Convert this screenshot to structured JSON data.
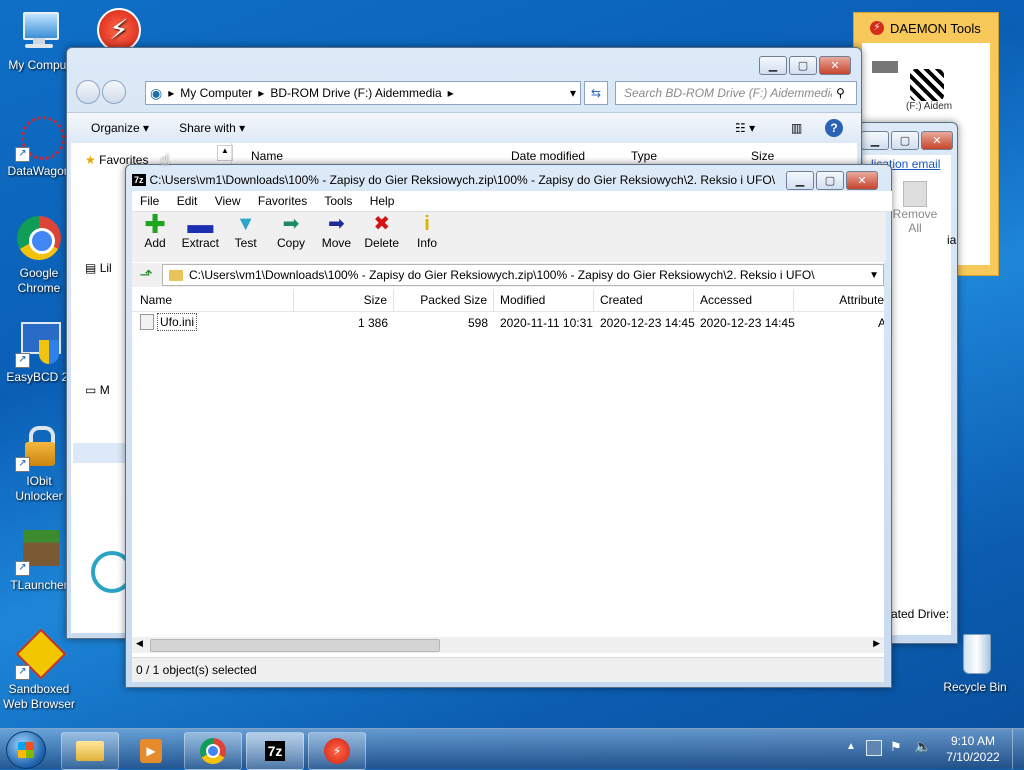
{
  "desktop": {
    "icons": [
      {
        "label": "My Comput",
        "icon": "computer-icon"
      },
      {
        "label": "",
        "icon": "daemon-tools-icon"
      },
      {
        "label": "DataWagon",
        "icon": "datawagon-icon"
      },
      {
        "label": "Google Chrome",
        "icon": "chrome-icon"
      },
      {
        "label": "EasyBCD 2.",
        "icon": "easybcd-icon"
      },
      {
        "label": "IObit Unlocker",
        "icon": "unlocker-icon"
      },
      {
        "label": "TLauncher",
        "icon": "tlauncher-icon"
      },
      {
        "label": "Sandboxed Web Browser",
        "icon": "sandbox-icon"
      },
      {
        "label": "Recycle Bin",
        "icon": "recycle-bin-icon"
      }
    ]
  },
  "daemon": {
    "title": "DAEMON Tools",
    "drive_label": "(F:) Aidem",
    "link_text": "lication email",
    "remove_all": "Remove All",
    "partial_text": "ia",
    "emulated": "ated Drive:"
  },
  "explorer": {
    "breadcrumb": [
      "My Computer",
      "BD-ROM Drive (F:) Aidemmedia"
    ],
    "search_placeholder": "Search BD-ROM Drive (F:) Aidemmedia",
    "toolbar": {
      "organize": "Organize",
      "share": "Share with"
    },
    "columns": {
      "name": "Name",
      "date": "Date modified",
      "type": "Type",
      "size": "Size"
    },
    "nav": {
      "favorites": "Favorites",
      "libraries": "Lil",
      "computer": "M"
    }
  },
  "sevenzip": {
    "title": "C:\\Users\\vm1\\Downloads\\100% - Zapisy do Gier Reksiowych.zip\\100% - Zapisy do Gier Reksiowych\\2. Reksio i UFO\\",
    "menu": [
      "File",
      "Edit",
      "View",
      "Favorites",
      "Tools",
      "Help"
    ],
    "tools": [
      {
        "label": "Add",
        "icon": "plus-icon",
        "color": "#1fa51f"
      },
      {
        "label": "Extract",
        "icon": "minus-icon",
        "color": "#1b2fb0"
      },
      {
        "label": "Test",
        "icon": "check-icon",
        "color": "#2aa7c9"
      },
      {
        "label": "Copy",
        "icon": "copy-arrow-icon",
        "color": "#1e8a6a"
      },
      {
        "label": "Move",
        "icon": "move-arrow-icon",
        "color": "#1c2a9a"
      },
      {
        "label": "Delete",
        "icon": "delete-x-icon",
        "color": "#d21414"
      },
      {
        "label": "Info",
        "icon": "info-icon",
        "color": "#d8b400"
      }
    ],
    "path": "C:\\Users\\vm1\\Downloads\\100% - Zapisy do Gier Reksiowych.zip\\100% - Zapisy do Gier Reksiowych\\2. Reksio i UFO\\",
    "columns": {
      "name": "Name",
      "size": "Size",
      "packed": "Packed Size",
      "modified": "Modified",
      "created": "Created",
      "accessed": "Accessed",
      "attributes": "Attribute"
    },
    "rows": [
      {
        "name": "Ufo.ini",
        "size": "1 386",
        "packed": "598",
        "modified": "2020-11-11 10:31",
        "created": "2020-12-23 14:45",
        "accessed": "2020-12-23 14:45",
        "attributes": "A"
      }
    ],
    "status": "0 / 1 object(s) selected"
  },
  "taskbar": {
    "time": "9:10 AM",
    "date": "7/10/2022",
    "buttons": [
      "explorer-icon",
      "media-player-icon",
      "chrome-icon",
      "7zip-icon",
      "daemon-tools-icon"
    ]
  }
}
